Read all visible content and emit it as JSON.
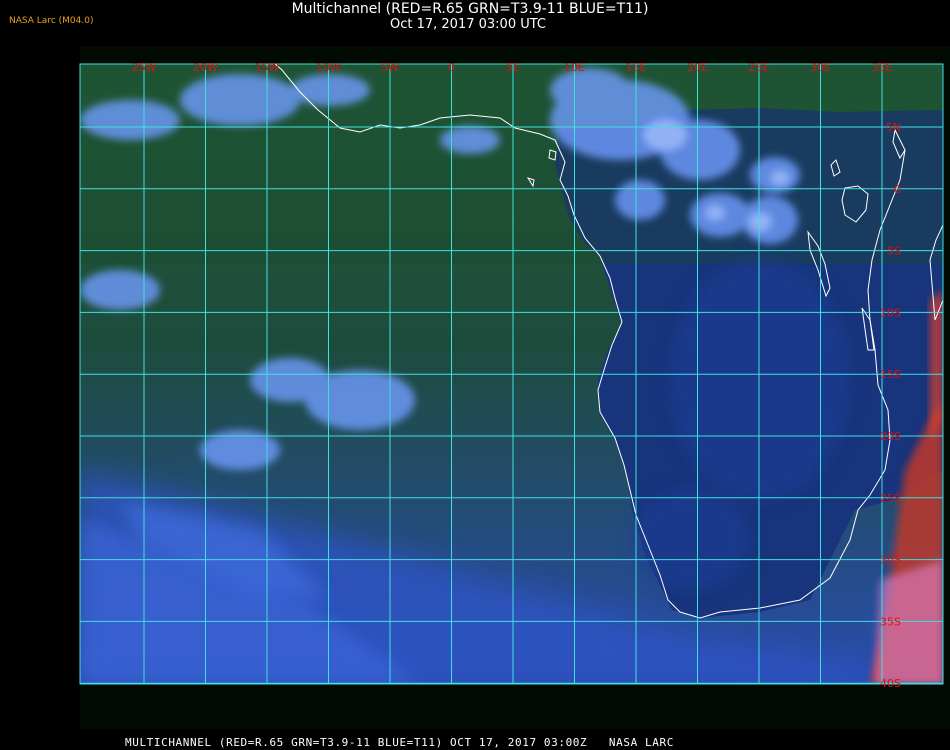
{
  "header": {
    "tag": "NASA Larc (M04.0)",
    "title": "Multichannel (RED=R.65 GRN=T3.9-11 BLUE=T11)",
    "subtitle": "Oct 17, 2017 03:00 UTC"
  },
  "footer": {
    "text": "MULTICHANNEL (RED=R.65 GRN=T3.9-11 BLUE=T11) OCT 17, 2017 03:00Z   NASA LARC"
  },
  "map": {
    "longitude_labels": [
      "25W",
      "20W",
      "15W",
      "10W",
      "5W",
      "0",
      "5E",
      "10E",
      "15E",
      "20E",
      "25E",
      "30E",
      "35E"
    ],
    "latitude_labels": [
      "5N",
      "0",
      "5S",
      "10S",
      "15S",
      "20S",
      "25S",
      "30S",
      "35S",
      "40S"
    ],
    "grid_color": "#40e0e0",
    "label_color": "#e01010",
    "coastline_color": "#ffffff",
    "land_color": "#1a3a8a",
    "ocean_color": "#1c4a2e",
    "cloud_color": "#5a8cff",
    "hot_surface_color": "#e04030"
  }
}
